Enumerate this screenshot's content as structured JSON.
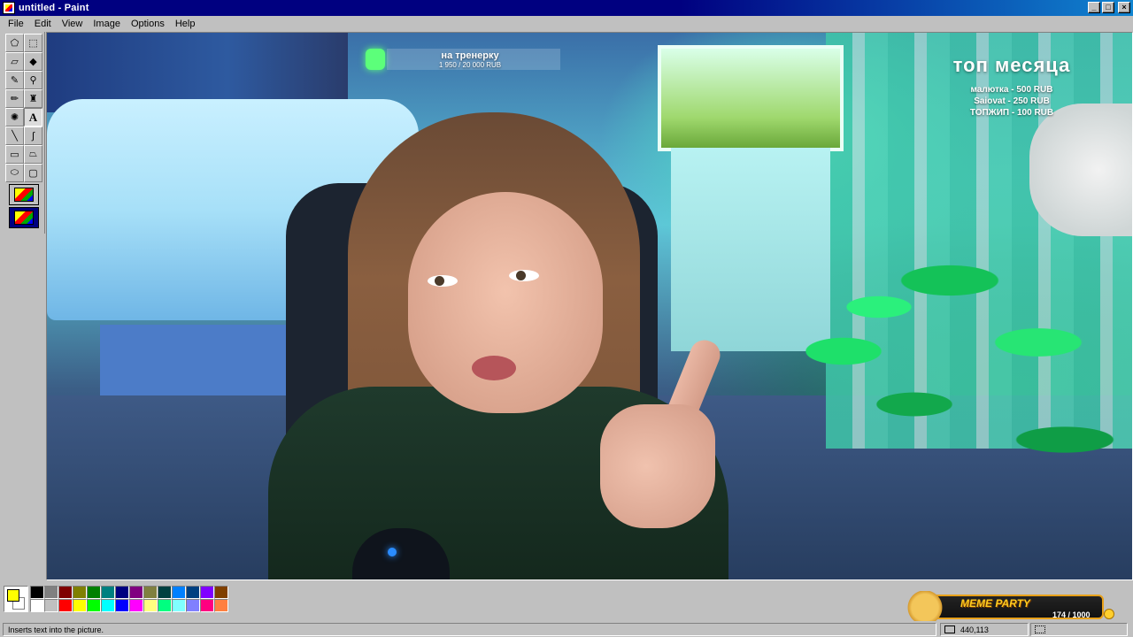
{
  "window": {
    "title": "untitled - Paint",
    "controls": {
      "minimize": "_",
      "maximize": "□",
      "close": "×"
    }
  },
  "menu": {
    "items": [
      {
        "label": "File"
      },
      {
        "label": "Edit"
      },
      {
        "label": "View"
      },
      {
        "label": "Image"
      },
      {
        "label": "Options"
      },
      {
        "label": "Help"
      }
    ]
  },
  "toolbox": {
    "tools": [
      {
        "name": "free-form-select-icon",
        "glyph": "⬠"
      },
      {
        "name": "select-icon",
        "glyph": "⬚"
      },
      {
        "name": "eraser-icon",
        "glyph": "▱"
      },
      {
        "name": "fill-icon",
        "glyph": "◆"
      },
      {
        "name": "pick-color-icon",
        "glyph": "✎"
      },
      {
        "name": "magnifier-icon",
        "glyph": "⚲"
      },
      {
        "name": "pencil-icon",
        "glyph": "✏"
      },
      {
        "name": "brush-icon",
        "glyph": "♜"
      },
      {
        "name": "airbrush-icon",
        "glyph": "✺"
      },
      {
        "name": "text-icon",
        "glyph": "A"
      },
      {
        "name": "line-icon",
        "glyph": "╲"
      },
      {
        "name": "curve-icon",
        "glyph": "∫"
      },
      {
        "name": "rectangle-icon",
        "glyph": "▭"
      },
      {
        "name": "polygon-icon",
        "glyph": "⏢"
      },
      {
        "name": "ellipse-icon",
        "glyph": "⬭"
      },
      {
        "name": "rounded-rectangle-icon",
        "glyph": "▢"
      }
    ],
    "active_tool": "text-icon"
  },
  "stream_overlay": {
    "goal": {
      "title": "на тренерку",
      "amount": "1 950 / 20 000 RUB"
    },
    "top_month": {
      "title": "топ месяца",
      "entries": [
        "малютка - 500 RUB",
        "Saiovat - 250 RUB",
        "ТОПЖИП - 100 RUB"
      ]
    },
    "meme_party": {
      "title": "MEME PARTY",
      "count": "174 / 1000"
    }
  },
  "palette": {
    "foreground": "#ffff00",
    "background": "#ffffff",
    "colors": [
      "#000000",
      "#808080",
      "#800000",
      "#808000",
      "#008000",
      "#008080",
      "#000080",
      "#800080",
      "#808040",
      "#004040",
      "#0080ff",
      "#004080",
      "#8000ff",
      "#804000",
      "#ffffff",
      "#c0c0c0",
      "#ff0000",
      "#ffff00",
      "#00ff00",
      "#00ffff",
      "#0000ff",
      "#ff00ff",
      "#ffff80",
      "#00ff80",
      "#80ffff",
      "#8080ff",
      "#ff0080",
      "#ff8040"
    ]
  },
  "status": {
    "text": "Inserts text into the picture.",
    "coords": "440,113",
    "size": ""
  }
}
